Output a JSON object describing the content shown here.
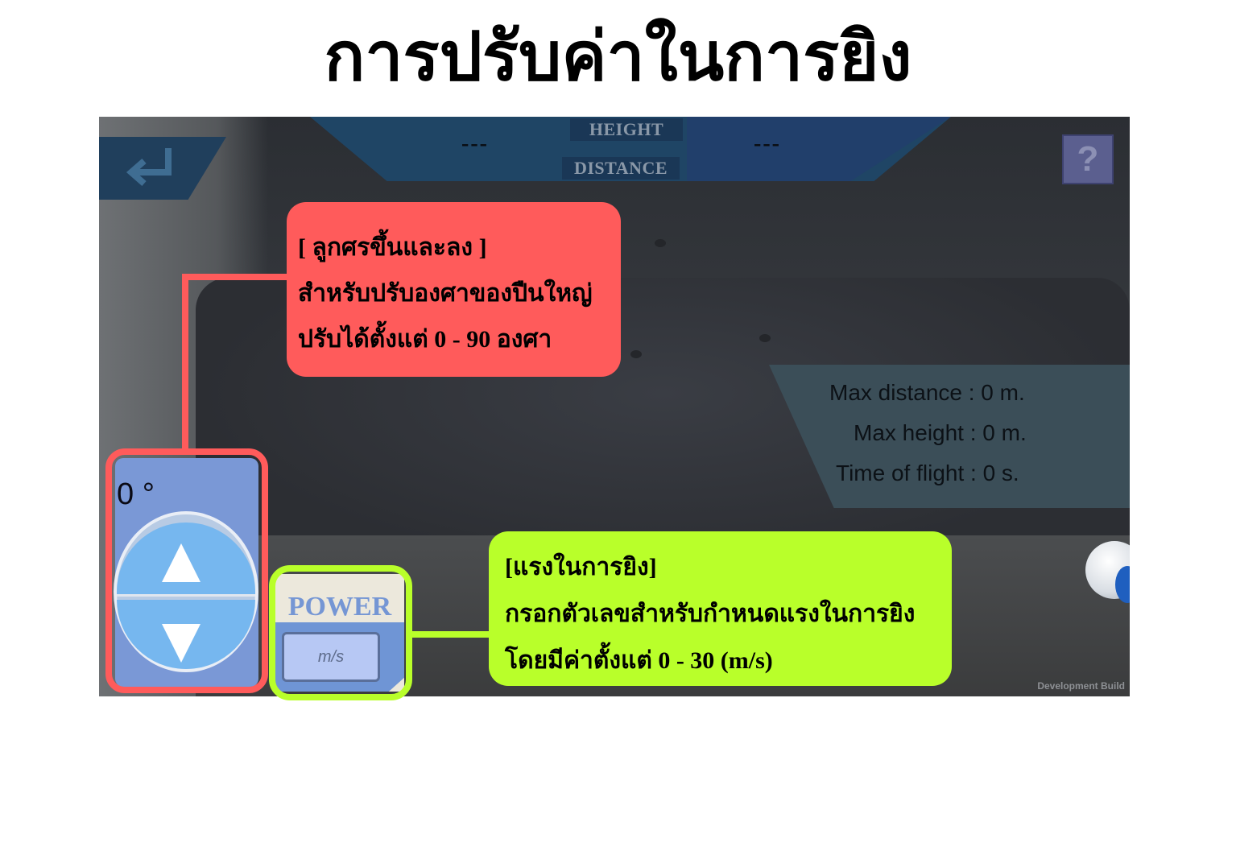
{
  "page": {
    "title": "การปรับค่าในการยิง"
  },
  "game": {
    "top_bar": {
      "height_label": "HEIGHT",
      "distance_label": "DISTANCE",
      "height_value": "---",
      "distance_value": "---"
    },
    "back_icon": "return-arrow-icon",
    "help_label": "?",
    "stats": {
      "max_distance": "Max distance : 0 m.",
      "max_height": "Max height : 0 m.",
      "time_of_flight": "Time of flight : 0 s."
    },
    "angle_control": {
      "value": "0 °",
      "up_icon": "triangle-up-icon",
      "down_icon": "triangle-down-icon"
    },
    "power_control": {
      "label": "POWER",
      "input_placeholder": "m/s"
    },
    "watermark": "Development Build"
  },
  "callouts": {
    "angle": {
      "line1": "[ ลูกศรขึ้นและลง ]",
      "line2": "สำหรับปรับองศาของปืนใหญ่",
      "line3": "ปรับได้ตั้งแต่ 0 - 90 องศา"
    },
    "power": {
      "line1": "[แรงในการยิง]",
      "line2": "กรอกตัวเลขสำหรับกำหนดแรงในการยิง",
      "line3": "โดยมีค่าตั้งแต่ 0 - 30 (m/s)"
    }
  },
  "colors": {
    "callout_red": "#ff5b5b",
    "callout_green": "#b9ff2a",
    "ui_blue": "#76b7ef",
    "bar_blue": "#1f4565"
  }
}
